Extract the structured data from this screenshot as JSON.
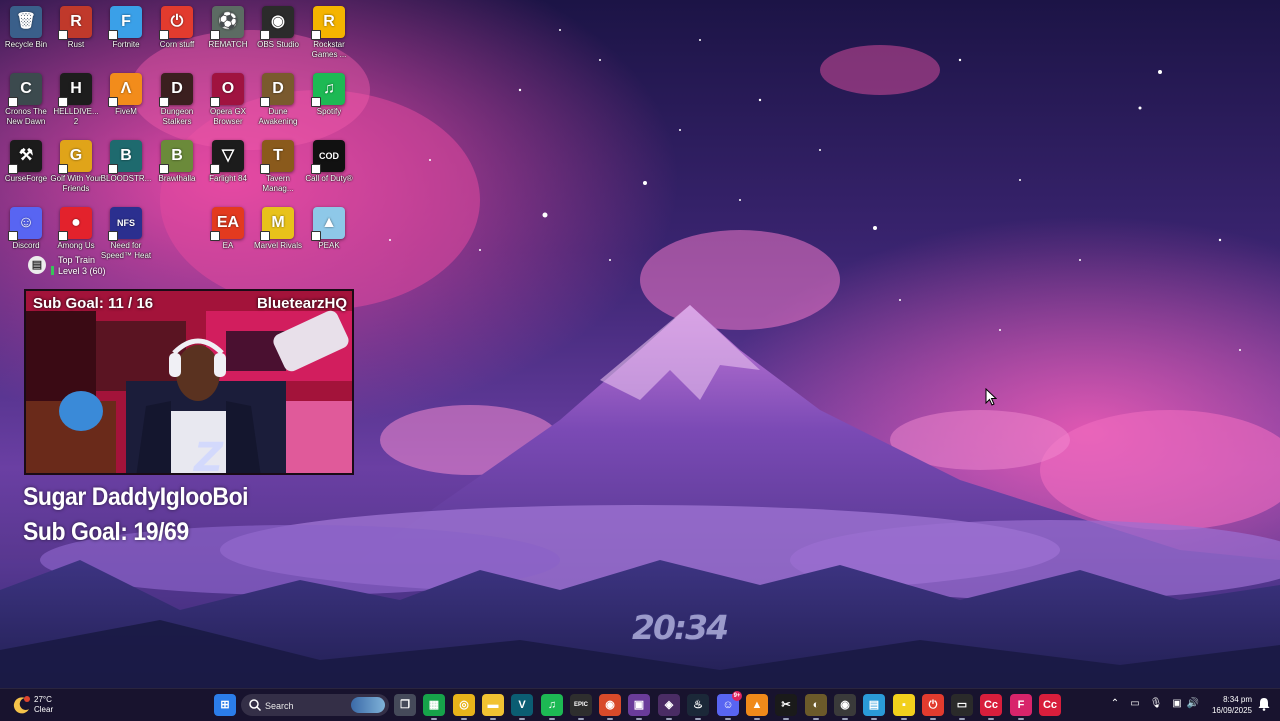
{
  "desktop": {
    "icons": [
      {
        "label": "Recycle Bin",
        "glyph": "🗑",
        "color": "#3a5f8a"
      },
      {
        "label": "Rust",
        "glyph": "R",
        "color": "#c0392b"
      },
      {
        "label": "Fortnite",
        "glyph": "F",
        "color": "#3aa0e8"
      },
      {
        "label": "Corn stuff",
        "glyph": "⏻",
        "color": "#e23b2e"
      },
      {
        "label": "REMATCH",
        "glyph": "⚽",
        "color": "#5c6b63"
      },
      {
        "label": "OBS Studio",
        "glyph": "◉",
        "color": "#2b2b2b"
      },
      {
        "label": "Rockstar Games ...",
        "glyph": "R",
        "color": "#f5b400"
      },
      {
        "label": "Cronos The New Dawn",
        "glyph": "C",
        "color": "#3c4a4e"
      },
      {
        "label": "HELLDIVE... 2",
        "glyph": "H",
        "color": "#1d1d1d"
      },
      {
        "label": "FiveM",
        "glyph": "Λ",
        "color": "#f28c1b"
      },
      {
        "label": "Dungeon Stalkers",
        "glyph": "D",
        "color": "#3b1f1f"
      },
      {
        "label": "Opera GX Browser",
        "glyph": "O",
        "color": "#a01340"
      },
      {
        "label": "Dune Awakening",
        "glyph": "D",
        "color": "#7a5a2e"
      },
      {
        "label": "Spotify",
        "glyph": "♫",
        "color": "#1db954"
      },
      {
        "label": "CurseForge",
        "glyph": "⚒",
        "color": "#1b1b1b"
      },
      {
        "label": "Golf With Your Friends",
        "glyph": "G",
        "color": "#e0a419"
      },
      {
        "label": "BLOODSTR...",
        "glyph": "B",
        "color": "#1e6a6e"
      },
      {
        "label": "Brawlhalla",
        "glyph": "B",
        "color": "#6b8a3a"
      },
      {
        "label": "Farlight 84",
        "glyph": "▽",
        "color": "#1c1c1c"
      },
      {
        "label": "Tavern Manag...",
        "glyph": "T",
        "color": "#8a5a1c"
      },
      {
        "label": "Call of Duty®",
        "glyph": "COD",
        "color": "#111111"
      },
      {
        "label": "Discord",
        "glyph": "☺",
        "color": "#5865f2"
      },
      {
        "label": "Among Us",
        "glyph": "●",
        "color": "#e3222c"
      },
      {
        "label": "Need for Speed™ Heat",
        "glyph": "NFS",
        "color": "#2b2f8f"
      },
      {
        "label": "EA",
        "glyph": "EA",
        "color": "#e33a1f"
      },
      {
        "label": "Marvel Rivals",
        "glyph": "M",
        "color": "#e8c21a"
      },
      {
        "label": "PEAK",
        "glyph": "▲",
        "color": "#8ec8e8"
      }
    ],
    "top_train": {
      "title": "Top Train",
      "subtitle": "Level 3  (60)"
    }
  },
  "stream_overlay": {
    "webcam_goal": "Sub Goal:  11 / 16",
    "channel": "BluetearzHQ",
    "line1": "Sugar DaddyIglooBoi",
    "line2": "Sub Goal: 19/69"
  },
  "desktop_clock": "20:34",
  "taskbar": {
    "weather": {
      "temp": "27°C",
      "condition": "Clear"
    },
    "search_placeholder": "Search",
    "apps": [
      {
        "name": "windows-start",
        "glyph": "⊞",
        "color": "#2b7de9"
      },
      {
        "name": "task-view",
        "glyph": "❐",
        "color": "#454a5a"
      },
      {
        "name": "xbox",
        "glyph": "▦",
        "color": "#16a34a"
      },
      {
        "name": "chrome",
        "glyph": "◎",
        "color": "#e8b31a"
      },
      {
        "name": "file-explorer",
        "glyph": "▬",
        "color": "#f1c232"
      },
      {
        "name": "vegas",
        "glyph": "V",
        "color": "#0b5d72"
      },
      {
        "name": "spotify",
        "glyph": "♫",
        "color": "#1db954"
      },
      {
        "name": "epic-games",
        "glyph": "EPIC",
        "color": "#2e2e2e"
      },
      {
        "name": "app-red",
        "glyph": "◉",
        "color": "#d84a2a"
      },
      {
        "name": "media-app",
        "glyph": "▣",
        "color": "#6a3c9a"
      },
      {
        "name": "opera-gx",
        "glyph": "◈",
        "color": "#4a2c64"
      },
      {
        "name": "steam",
        "glyph": "♨",
        "color": "#1b2838"
      },
      {
        "name": "discord",
        "glyph": "☺",
        "color": "#5865f2"
      },
      {
        "name": "vlc",
        "glyph": "▲",
        "color": "#f08a1a"
      },
      {
        "name": "capcut",
        "glyph": "✂",
        "color": "#1a1a1a"
      },
      {
        "name": "dune",
        "glyph": "◐",
        "color": "#6b5a2a"
      },
      {
        "name": "obs",
        "glyph": "◉",
        "color": "#3a3a3a"
      },
      {
        "name": "store",
        "glyph": "▤",
        "color": "#2a9ad8"
      },
      {
        "name": "sticky-notes",
        "glyph": "▪",
        "color": "#f2d01c"
      },
      {
        "name": "app-circle",
        "glyph": "⏻",
        "color": "#e23b2e"
      },
      {
        "name": "terminal",
        "glyph": "▭",
        "color": "#2a2a2a"
      },
      {
        "name": "creative-cloud",
        "glyph": "Cc",
        "color": "#d81e3c"
      },
      {
        "name": "fortnite",
        "glyph": "F",
        "color": "#d8246b"
      },
      {
        "name": "creative-cloud-2",
        "glyph": "Cc",
        "color": "#d81e3c"
      }
    ],
    "discord_badge": "9+",
    "time": "8:34 pm",
    "date": "16/09/2025"
  }
}
